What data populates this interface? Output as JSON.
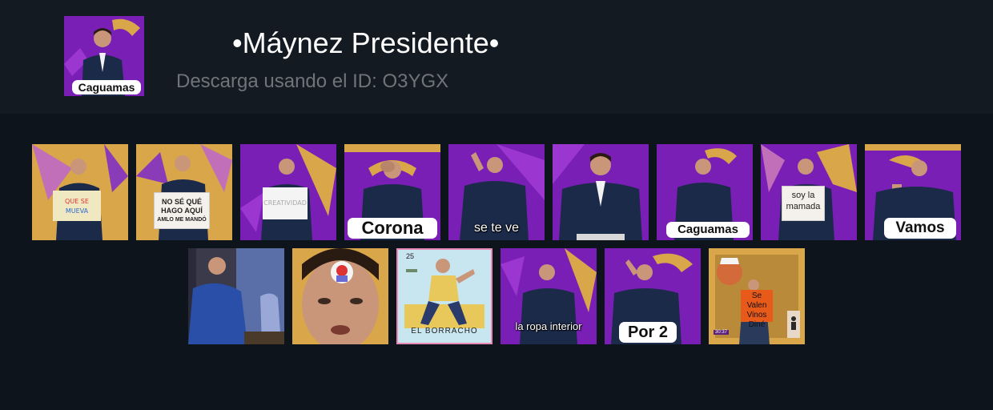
{
  "pack": {
    "title": "•Máynez Presidente•",
    "id_line": "Descarga usando el ID: O3YGX",
    "cover_caption": "Caguamas"
  },
  "colors": {
    "purple": "#7a1fb6",
    "orange": "#d9a64a",
    "header_bg": "#131a22",
    "page_bg": "#0e141b"
  },
  "stickers": [
    {
      "name": "sticker-protest-sign",
      "caption": ""
    },
    {
      "name": "sticker-no-se-que-hago-aqui",
      "sign": "NO SÉ QUÉ HAGO AQUÍ",
      "sign_sub": "AMLO ME MANDÓ"
    },
    {
      "name": "sticker-white-sign",
      "caption": ""
    },
    {
      "name": "sticker-corona",
      "caption": "Corona"
    },
    {
      "name": "sticker-se-te-ve",
      "caption": "se te ve"
    },
    {
      "name": "sticker-close-up",
      "caption": ""
    },
    {
      "name": "sticker-caguamas",
      "caption": "Caguamas"
    },
    {
      "name": "sticker-soy-la-mamada",
      "sign": "soy la mamada"
    },
    {
      "name": "sticker-vamos",
      "caption": "Vamos"
    },
    {
      "name": "sticker-side-view",
      "caption": ""
    },
    {
      "name": "sticker-face-closeup",
      "caption": ""
    },
    {
      "name": "sticker-el-borracho",
      "card_number": "25",
      "card_title": "EL BORRACHO"
    },
    {
      "name": "sticker-la-ropa-interior",
      "caption": "la ropa interior"
    },
    {
      "name": "sticker-por-2",
      "caption": "Por 2"
    },
    {
      "name": "sticker-se-valen-vinos-dine",
      "sign": "Se Valen Vinos Diné",
      "timestamp": "30:37"
    }
  ]
}
